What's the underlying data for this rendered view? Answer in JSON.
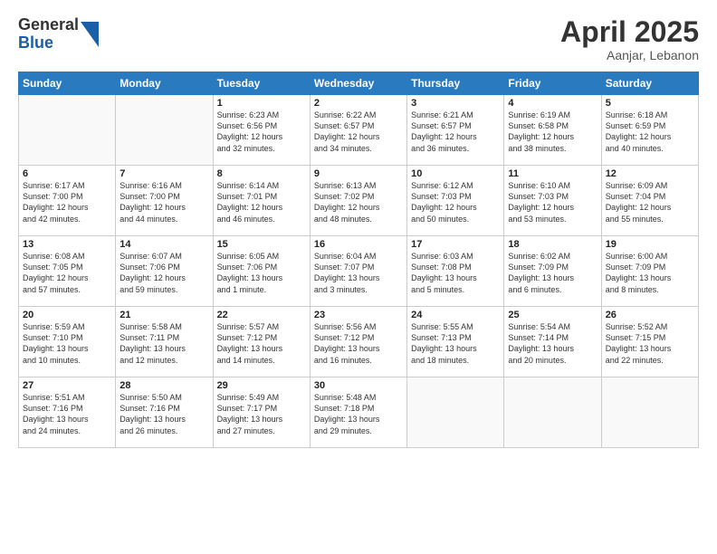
{
  "header": {
    "logo_general": "General",
    "logo_blue": "Blue",
    "month_title": "April 2025",
    "location": "Aanjar, Lebanon"
  },
  "weekdays": [
    "Sunday",
    "Monday",
    "Tuesday",
    "Wednesday",
    "Thursday",
    "Friday",
    "Saturday"
  ],
  "weeks": [
    [
      {
        "day": "",
        "info": ""
      },
      {
        "day": "",
        "info": ""
      },
      {
        "day": "1",
        "info": "Sunrise: 6:23 AM\nSunset: 6:56 PM\nDaylight: 12 hours\nand 32 minutes."
      },
      {
        "day": "2",
        "info": "Sunrise: 6:22 AM\nSunset: 6:57 PM\nDaylight: 12 hours\nand 34 minutes."
      },
      {
        "day": "3",
        "info": "Sunrise: 6:21 AM\nSunset: 6:57 PM\nDaylight: 12 hours\nand 36 minutes."
      },
      {
        "day": "4",
        "info": "Sunrise: 6:19 AM\nSunset: 6:58 PM\nDaylight: 12 hours\nand 38 minutes."
      },
      {
        "day": "5",
        "info": "Sunrise: 6:18 AM\nSunset: 6:59 PM\nDaylight: 12 hours\nand 40 minutes."
      }
    ],
    [
      {
        "day": "6",
        "info": "Sunrise: 6:17 AM\nSunset: 7:00 PM\nDaylight: 12 hours\nand 42 minutes."
      },
      {
        "day": "7",
        "info": "Sunrise: 6:16 AM\nSunset: 7:00 PM\nDaylight: 12 hours\nand 44 minutes."
      },
      {
        "day": "8",
        "info": "Sunrise: 6:14 AM\nSunset: 7:01 PM\nDaylight: 12 hours\nand 46 minutes."
      },
      {
        "day": "9",
        "info": "Sunrise: 6:13 AM\nSunset: 7:02 PM\nDaylight: 12 hours\nand 48 minutes."
      },
      {
        "day": "10",
        "info": "Sunrise: 6:12 AM\nSunset: 7:03 PM\nDaylight: 12 hours\nand 50 minutes."
      },
      {
        "day": "11",
        "info": "Sunrise: 6:10 AM\nSunset: 7:03 PM\nDaylight: 12 hours\nand 53 minutes."
      },
      {
        "day": "12",
        "info": "Sunrise: 6:09 AM\nSunset: 7:04 PM\nDaylight: 12 hours\nand 55 minutes."
      }
    ],
    [
      {
        "day": "13",
        "info": "Sunrise: 6:08 AM\nSunset: 7:05 PM\nDaylight: 12 hours\nand 57 minutes."
      },
      {
        "day": "14",
        "info": "Sunrise: 6:07 AM\nSunset: 7:06 PM\nDaylight: 12 hours\nand 59 minutes."
      },
      {
        "day": "15",
        "info": "Sunrise: 6:05 AM\nSunset: 7:06 PM\nDaylight: 13 hours\nand 1 minute."
      },
      {
        "day": "16",
        "info": "Sunrise: 6:04 AM\nSunset: 7:07 PM\nDaylight: 13 hours\nand 3 minutes."
      },
      {
        "day": "17",
        "info": "Sunrise: 6:03 AM\nSunset: 7:08 PM\nDaylight: 13 hours\nand 5 minutes."
      },
      {
        "day": "18",
        "info": "Sunrise: 6:02 AM\nSunset: 7:09 PM\nDaylight: 13 hours\nand 6 minutes."
      },
      {
        "day": "19",
        "info": "Sunrise: 6:00 AM\nSunset: 7:09 PM\nDaylight: 13 hours\nand 8 minutes."
      }
    ],
    [
      {
        "day": "20",
        "info": "Sunrise: 5:59 AM\nSunset: 7:10 PM\nDaylight: 13 hours\nand 10 minutes."
      },
      {
        "day": "21",
        "info": "Sunrise: 5:58 AM\nSunset: 7:11 PM\nDaylight: 13 hours\nand 12 minutes."
      },
      {
        "day": "22",
        "info": "Sunrise: 5:57 AM\nSunset: 7:12 PM\nDaylight: 13 hours\nand 14 minutes."
      },
      {
        "day": "23",
        "info": "Sunrise: 5:56 AM\nSunset: 7:12 PM\nDaylight: 13 hours\nand 16 minutes."
      },
      {
        "day": "24",
        "info": "Sunrise: 5:55 AM\nSunset: 7:13 PM\nDaylight: 13 hours\nand 18 minutes."
      },
      {
        "day": "25",
        "info": "Sunrise: 5:54 AM\nSunset: 7:14 PM\nDaylight: 13 hours\nand 20 minutes."
      },
      {
        "day": "26",
        "info": "Sunrise: 5:52 AM\nSunset: 7:15 PM\nDaylight: 13 hours\nand 22 minutes."
      }
    ],
    [
      {
        "day": "27",
        "info": "Sunrise: 5:51 AM\nSunset: 7:16 PM\nDaylight: 13 hours\nand 24 minutes."
      },
      {
        "day": "28",
        "info": "Sunrise: 5:50 AM\nSunset: 7:16 PM\nDaylight: 13 hours\nand 26 minutes."
      },
      {
        "day": "29",
        "info": "Sunrise: 5:49 AM\nSunset: 7:17 PM\nDaylight: 13 hours\nand 27 minutes."
      },
      {
        "day": "30",
        "info": "Sunrise: 5:48 AM\nSunset: 7:18 PM\nDaylight: 13 hours\nand 29 minutes."
      },
      {
        "day": "",
        "info": ""
      },
      {
        "day": "",
        "info": ""
      },
      {
        "day": "",
        "info": ""
      }
    ]
  ]
}
